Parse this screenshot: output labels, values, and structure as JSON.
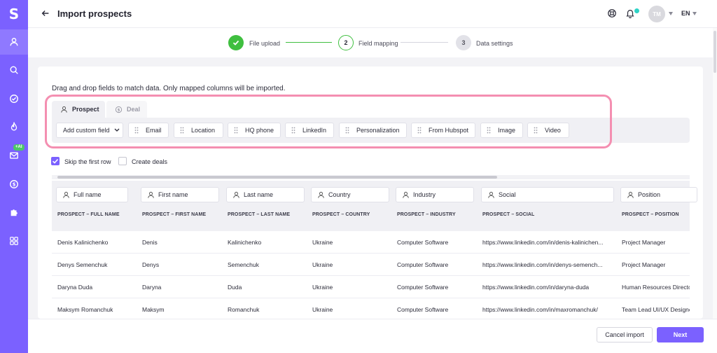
{
  "app": {
    "logo": "S",
    "title": "Import prospects",
    "avatar_initials": "TM",
    "language": "EN"
  },
  "sidebar": {
    "items": [
      {
        "name": "prospects",
        "icon": "person-icon",
        "active": true
      },
      {
        "name": "search",
        "icon": "search-icon"
      },
      {
        "name": "tasks",
        "icon": "check-circle-icon"
      },
      {
        "name": "hot",
        "icon": "flame-icon"
      },
      {
        "name": "email",
        "icon": "mail-icon",
        "badge": "+AI"
      },
      {
        "name": "billing",
        "icon": "dollar-icon"
      },
      {
        "name": "integrations",
        "icon": "puzzle-icon"
      },
      {
        "name": "apps",
        "icon": "grid-icon"
      }
    ]
  },
  "stepper": {
    "steps": [
      {
        "number": "",
        "label": "File upload",
        "state": "done"
      },
      {
        "number": "2",
        "label": "Field mapping",
        "state": "active"
      },
      {
        "number": "3",
        "label": "Data settings",
        "state": "pending"
      }
    ]
  },
  "mapping": {
    "instructions": "Drag and drop fields to match data. Only mapped columns will be imported.",
    "tabs": [
      {
        "label": "Prospect",
        "active": true
      },
      {
        "label": "Deal",
        "active": false
      }
    ],
    "add_field_label": "Add custom field",
    "fields": [
      "Email",
      "Location",
      "HQ phone",
      "LinkedIn",
      "Personalization",
      "From Hubspot",
      "Image",
      "Video"
    ]
  },
  "options": {
    "skip_first_row": {
      "label": "Skip the first row",
      "checked": true
    },
    "create_deals": {
      "label": "Create deals",
      "checked": false
    }
  },
  "table": {
    "columns": [
      {
        "mapped": "Full name",
        "header": "PROSPECT – FULL NAME"
      },
      {
        "mapped": "First name",
        "header": "PROSPECT – FIRST NAME"
      },
      {
        "mapped": "Last name",
        "header": "PROSPECT – LAST NAME"
      },
      {
        "mapped": "Country",
        "header": "PROSPECT – COUNTRY"
      },
      {
        "mapped": "Industry",
        "header": "PROSPECT – INDUSTRY"
      },
      {
        "mapped": "Social",
        "header": "PROSPECT – SOCIAL"
      },
      {
        "mapped": "Position",
        "header": "PROSPECT – POSITION"
      }
    ],
    "rows": [
      [
        "Denis Kalinichenko",
        "Denis",
        "Kalinichenko",
        "Ukraine",
        "Computer Software",
        "https://www.linkedin.com/in/denis-kalinichen...",
        "Project Manager"
      ],
      [
        "Denys Semenchuk",
        "Denys",
        "Semenchuk",
        "Ukraine",
        "Computer Software",
        "https://www.linkedin.com/in/denys-semench...",
        "Project Manager"
      ],
      [
        "Daryna Duda",
        "Daryna",
        "Duda",
        "Ukraine",
        "Computer Software",
        "https://www.linkedin.com/in/daryna-duda",
        "Human Resources Directo"
      ],
      [
        "Maksym Romanchuk",
        "Maksym",
        "Romanchuk",
        "Ukraine",
        "Computer Software",
        "https://www.linkedin.com/in/maxromanchuk/",
        "Team Lead UI/UX Designe"
      ]
    ]
  },
  "footer": {
    "cancel_label": "Cancel import",
    "next_label": "Next"
  },
  "colors": {
    "accent": "#7b61ff",
    "success": "#3fbf3f",
    "highlight": "#f48fb1",
    "notification": "#2ed3c6"
  }
}
